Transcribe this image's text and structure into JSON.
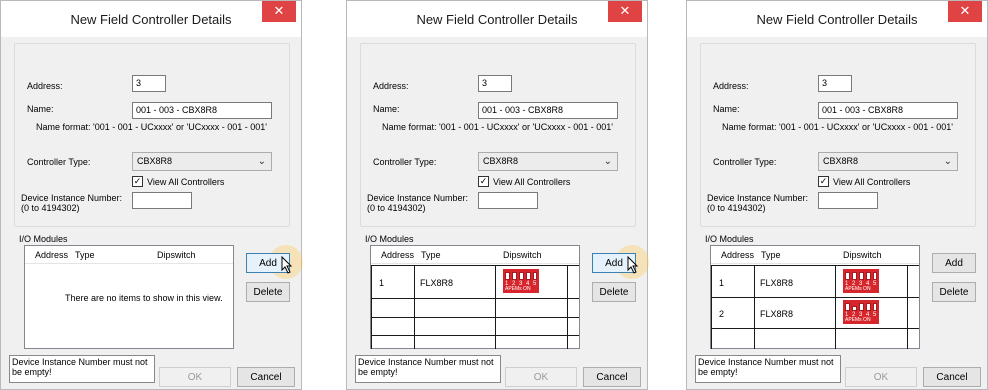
{
  "dialogs": [
    {
      "title": "New Field Controller Details",
      "close_glyph": "✕",
      "address_label": "Address:",
      "address_value": "3",
      "name_label": "Name:",
      "name_value": "001 - 003 - CBX8R8",
      "name_format": "Name format: '001 - 001 - UCxxxx' or 'UCxxxx - 001 - 001'",
      "controller_type_label": "Controller Type:",
      "controller_type_value": "CBX8R8",
      "view_all_label": "View All Controllers",
      "device_instance_label": "Device Instance Number: (0 to 4194302)",
      "device_instance_value": "",
      "io_modules_label": "I/O Modules",
      "columns": [
        "Address",
        "Type",
        "Dipswitch"
      ],
      "empty_text": "There are no items to show in this view.",
      "add_label": "Add",
      "delete_label": "Delete",
      "status_text": "Device Instance Number must not be empty!",
      "ok_label": "OK",
      "cancel_label": "Cancel"
    },
    {
      "title": "New Field Controller Details",
      "close_glyph": "✕",
      "address_label": "Address:",
      "address_value": "3",
      "name_label": "Name:",
      "name_value": "001 - 003 - CBX8R8",
      "name_format": "Name format: '001 - 001 - UCxxxx' or 'UCxxxx - 001 - 001'",
      "controller_type_label": "Controller Type:",
      "controller_type_value": "CBX8R8",
      "view_all_label": "View All Controllers",
      "device_instance_label": "Device Instance Number: (0 to 4194302)",
      "device_instance_value": "",
      "io_modules_label": "I/O Modules",
      "columns": [
        "Address",
        "Type",
        "Dipswitch"
      ],
      "rows": [
        {
          "address": "1",
          "type": "FLX8R8",
          "dip_nums": "1 2 3 4 5",
          "dip_text": "APEMs  ON"
        }
      ],
      "add_label": "Add",
      "delete_label": "Delete",
      "status_text": "Device Instance Number must not be empty!",
      "ok_label": "OK",
      "cancel_label": "Cancel"
    },
    {
      "title": "New Field Controller Details",
      "close_glyph": "✕",
      "address_label": "Address:",
      "address_value": "3",
      "name_label": "Name:",
      "name_value": "001 - 003 - CBX8R8",
      "name_format": "Name format: '001 - 001 - UCxxxx' or 'UCxxxx - 001 - 001'",
      "controller_type_label": "Controller Type:",
      "controller_type_value": "CBX8R8",
      "view_all_label": "View All Controllers",
      "device_instance_label": "Device Instance Number: (0 to 4194302)",
      "device_instance_value": "",
      "io_modules_label": "I/O Modules",
      "columns": [
        "Address",
        "Type",
        "Dipswitch"
      ],
      "rows": [
        {
          "address": "1",
          "type": "FLX8R8",
          "dip_nums": "1 2 3 4 5",
          "dip_text": "APEMs  ON"
        },
        {
          "address": "2",
          "type": "FLX8R8",
          "dip_nums": "1 2 3 4 5",
          "dip_text": "APEMs  ON"
        }
      ],
      "add_label": "Add",
      "delete_label": "Delete",
      "status_text": "Device Instance Number must not be empty!",
      "ok_label": "OK",
      "cancel_label": "Cancel"
    }
  ],
  "checkbox_mark": "✓",
  "combo_arrow": "⌄",
  "colors": {
    "close": "#e04343",
    "dipswitch": "#d6262c",
    "accent": "#3c7fb1"
  }
}
